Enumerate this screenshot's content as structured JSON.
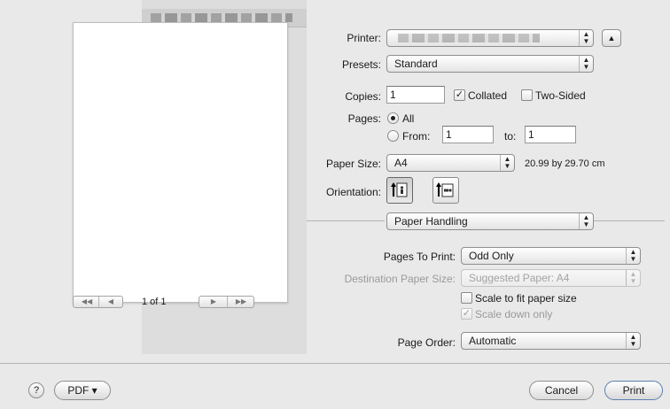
{
  "printer": {
    "label": "Printer:",
    "value": ""
  },
  "presets": {
    "label": "Presets:",
    "value": "Standard"
  },
  "copies": {
    "label": "Copies:",
    "value": "1",
    "collated_label": "Collated",
    "collated_checked": true,
    "two_sided_label": "Two-Sided",
    "two_sided_checked": false
  },
  "pages": {
    "label": "Pages:",
    "all_label": "All",
    "from_label": "From:",
    "from_value": "1",
    "to_label": "to:",
    "to_value": "1",
    "selected": "All"
  },
  "paper_size": {
    "label": "Paper Size:",
    "value": "A4",
    "dimensions": "20.99 by 29.70 cm"
  },
  "orientation": {
    "label": "Orientation:",
    "selected": "portrait"
  },
  "section": {
    "value": "Paper Handling"
  },
  "pages_to_print": {
    "label": "Pages To Print:",
    "value": "Odd Only"
  },
  "destination_paper_size": {
    "label": "Destination Paper Size:",
    "value": "Suggested Paper: A4"
  },
  "scale_to_fit": {
    "label": "Scale to fit paper size",
    "checked": false
  },
  "scale_down": {
    "label": "Scale down only",
    "checked": true
  },
  "page_order": {
    "label": "Page Order:",
    "value": "Automatic"
  },
  "preview": {
    "page_indicator": "1 of 1"
  },
  "footer": {
    "help": "?",
    "pdf_label": "PDF ▾",
    "cancel_label": "Cancel",
    "print_label": "Print"
  },
  "icons": [
    "disclosure-triangle-icon",
    "first-page-icon",
    "previous-page-icon",
    "next-page-icon",
    "last-page-icon",
    "portrait-icon",
    "landscape-icon",
    "help-icon"
  ]
}
